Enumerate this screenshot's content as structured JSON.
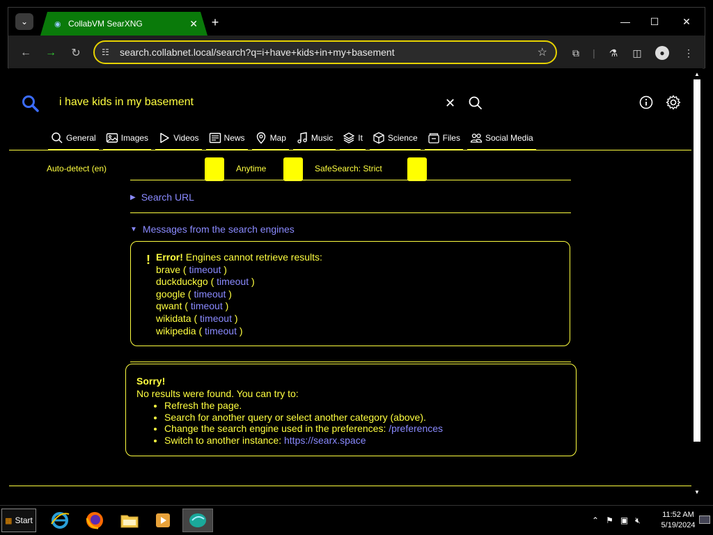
{
  "browser": {
    "tab_title": "CollabVM SearXNG",
    "url": "search.collabnet.local/search?q=i+have+kids+in+my+basement",
    "new_tab_label": "+",
    "minimize": "—",
    "maximize": "☐",
    "close": "✕"
  },
  "search": {
    "query": "i have kids in my basement"
  },
  "categories": [
    {
      "label": "General",
      "icon": "search-icon"
    },
    {
      "label": "Images",
      "icon": "image-icon"
    },
    {
      "label": "Videos",
      "icon": "play-icon"
    },
    {
      "label": "News",
      "icon": "newspaper-icon"
    },
    {
      "label": "Map",
      "icon": "map-pin-icon"
    },
    {
      "label": "Music",
      "icon": "music-icon"
    },
    {
      "label": "It",
      "icon": "layers-icon"
    },
    {
      "label": "Science",
      "icon": "cube-icon"
    },
    {
      "label": "Files",
      "icon": "files-icon"
    },
    {
      "label": "Social Media",
      "icon": "people-icon"
    }
  ],
  "filters": {
    "language": "Auto-detect (en)",
    "time_range": "Anytime",
    "safesearch": "SafeSearch: Strict"
  },
  "search_url_label": "Search URL",
  "messages_label": "Messages from the search engines",
  "error": {
    "title": "Error!",
    "text": "Engines cannot retrieve results:",
    "engines": [
      {
        "name": "brave",
        "reason": "timeout"
      },
      {
        "name": "duckduckgo",
        "reason": "timeout"
      },
      {
        "name": "google",
        "reason": "timeout"
      },
      {
        "name": "qwant",
        "reason": "timeout"
      },
      {
        "name": "wikidata",
        "reason": "timeout"
      },
      {
        "name": "wikipedia",
        "reason": "timeout"
      }
    ]
  },
  "sorry": {
    "title": "Sorry!",
    "subtitle": "No results were found. You can try to:",
    "items": [
      {
        "text": "Refresh the page.",
        "link": ""
      },
      {
        "text": "Search for another query or select another category (above).",
        "link": ""
      },
      {
        "text": "Change the search engine used in the preferences: ",
        "link": "/preferences"
      },
      {
        "text": "Switch to another instance: ",
        "link": "https://searx.space"
      }
    ]
  },
  "taskbar": {
    "start_label": "Start",
    "time": "11:52 AM",
    "date": "5/19/2024"
  },
  "colors": {
    "accent": "#ffff40",
    "link": "#8a8aff",
    "tab_active": "#0a7a0a"
  }
}
